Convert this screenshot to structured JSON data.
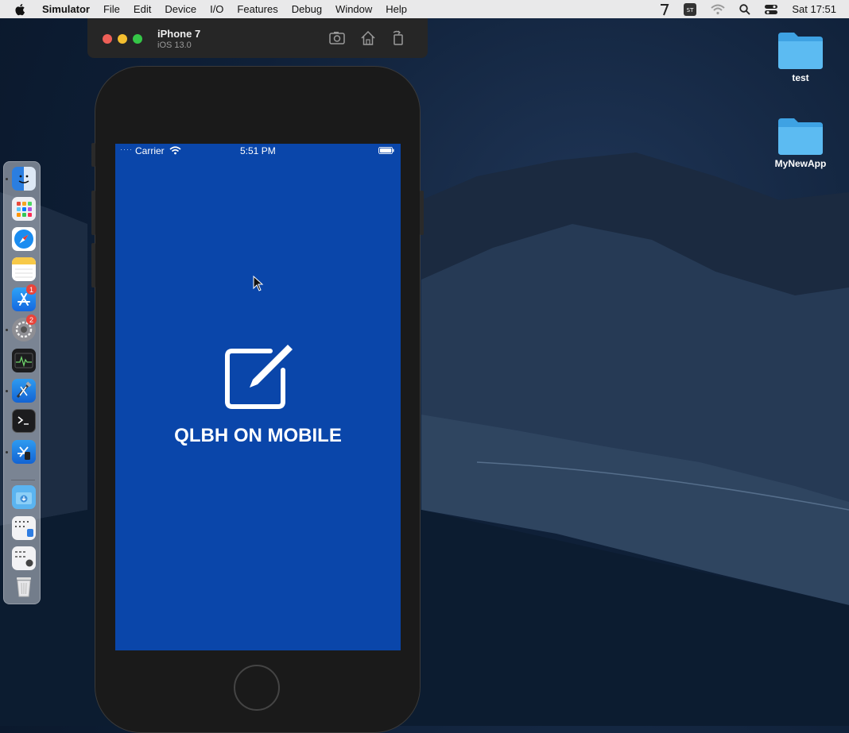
{
  "menubar": {
    "app_name": "Simulator",
    "items": [
      "File",
      "Edit",
      "Device",
      "I/O",
      "Features",
      "Debug",
      "Window",
      "Help"
    ],
    "clock": "Sat 17:51",
    "status_icons": [
      "pen-tool-icon",
      "input-source-icon",
      "wifi-icon",
      "spotlight-search-icon",
      "control-center-icon"
    ]
  },
  "simulator": {
    "device_name": "iPhone 7",
    "os_version": "iOS 13.0",
    "toolbar_icons": [
      "screenshot-icon",
      "home-icon",
      "rotate-icon"
    ]
  },
  "phone": {
    "status": {
      "carrier": "Carrier",
      "time": "5:51 PM"
    },
    "app_title": "QLBH ON MOBILE",
    "background": "#0a46aa"
  },
  "desktop": {
    "folders": [
      {
        "label": "test"
      },
      {
        "label": "MyNewApp"
      }
    ]
  },
  "dock": {
    "apps": [
      {
        "name": "finder-icon"
      },
      {
        "name": "launchpad-icon"
      },
      {
        "name": "safari-icon"
      },
      {
        "name": "notes-icon"
      },
      {
        "name": "app-store-icon",
        "badge": "1"
      },
      {
        "name": "system-preferences-icon",
        "badge": "2"
      },
      {
        "name": "activity-monitor-icon"
      },
      {
        "name": "xcode-icon"
      },
      {
        "name": "terminal-icon"
      },
      {
        "name": "simulator-icon"
      },
      {
        "name": "downloads-folder-icon"
      },
      {
        "name": "document-stack-icon"
      },
      {
        "name": "document-stack-2-icon"
      },
      {
        "name": "trash-icon"
      }
    ]
  },
  "colors": {
    "screen_blue": "#0a46aa",
    "menubar_bg": "#e9e9ea",
    "folder_blue": "#4fb3ee"
  }
}
